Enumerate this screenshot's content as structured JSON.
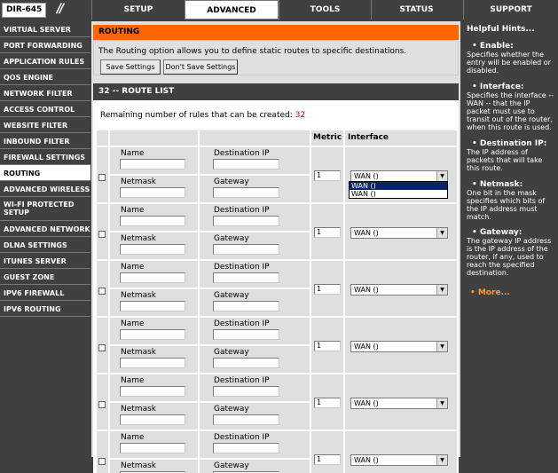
{
  "brand": {
    "model": "DIR-645"
  },
  "tabs": [
    {
      "label": "SETUP"
    },
    {
      "label": "ADVANCED"
    },
    {
      "label": "TOOLS"
    },
    {
      "label": "STATUS"
    },
    {
      "label": "SUPPORT"
    }
  ],
  "sidebar": {
    "items": [
      {
        "label": "VIRTUAL SERVER"
      },
      {
        "label": "PORT FORWARDING"
      },
      {
        "label": "APPLICATION RULES"
      },
      {
        "label": "QOS ENGINE"
      },
      {
        "label": "NETWORK FILTER"
      },
      {
        "label": "ACCESS CONTROL"
      },
      {
        "label": "WEBSITE FILTER"
      },
      {
        "label": "INBOUND FILTER"
      },
      {
        "label": "FIREWALL SETTINGS"
      },
      {
        "label": "ROUTING"
      },
      {
        "label": "ADVANCED WIRELESS"
      },
      {
        "label": "WI-FI PROTECTED SETUP"
      },
      {
        "label": "ADVANCED NETWORK"
      },
      {
        "label": "DLNA SETTINGS"
      },
      {
        "label": "ITUNES SERVER"
      },
      {
        "label": "GUEST ZONE"
      },
      {
        "label": "IPV6 FIREWALL"
      },
      {
        "label": "IPV6 ROUTING"
      }
    ]
  },
  "routing": {
    "title": "ROUTING",
    "description": "The Routing option allows you to define static routes to specific destinations.",
    "save_label": "Save Settings",
    "dont_save_label": "Don't Save Settings"
  },
  "route_list": {
    "title": "32 -- ROUTE LIST",
    "remaining_text": "Remaining number of rules that can be created:",
    "remaining_count": "32",
    "header_metric": "Metric",
    "header_interface": "Interface",
    "label_name": "Name",
    "label_destination": "Destination IP",
    "label_netmask": "Netmask",
    "label_gateway": "Gateway",
    "rows": [
      {
        "metric": "1",
        "interface": "WAN ()"
      },
      {
        "metric": "1",
        "interface": "WAN ()"
      },
      {
        "metric": "1",
        "interface": "WAN ()"
      },
      {
        "metric": "1",
        "interface": "WAN ()"
      },
      {
        "metric": "1",
        "interface": "WAN ()"
      },
      {
        "metric": "1",
        "interface": "WAN ()"
      }
    ],
    "dropdown_options": [
      "WAN ()",
      "WAN ()"
    ]
  },
  "help": {
    "title": "Helpful Hints...",
    "hints": [
      {
        "heading": "Enable:",
        "text": "Specifies whether the entry will be enabled or disabled."
      },
      {
        "heading": "Interface:",
        "text": "Specifies the interface -- WAN -- that the IP packet must use to transit out of the router, when this route is used."
      },
      {
        "heading": "Destination IP:",
        "text": "The IP address of packets that will take this route."
      },
      {
        "heading": "Netmask:",
        "text": "One bit in the mask specifies which bits of the IP address must match."
      },
      {
        "heading": "Gateway:",
        "text": "The gateway IP address is the IP address of the router, if any, used to reach the specified destination."
      }
    ],
    "more_label": "More..."
  },
  "colors": {
    "accent": "#ff6600",
    "chrome": "#404040",
    "panel": "#dfdfdf"
  }
}
